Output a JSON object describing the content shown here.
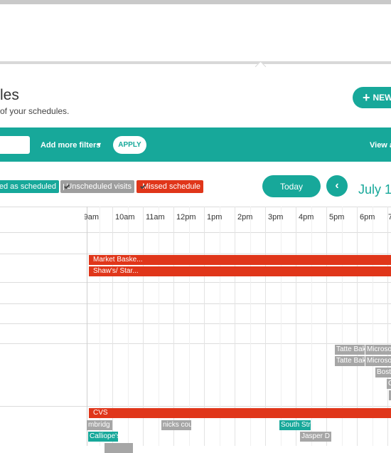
{
  "page": {
    "title": "les",
    "subtitle": "of your schedules.",
    "new_button": "NEW"
  },
  "filters": {
    "add_more_filters": "Add more filters",
    "apply": "APPLY",
    "view_all": "View a"
  },
  "legend": {
    "scheduled": "sited as scheduled",
    "unscheduled": "Unscheduled visits",
    "missed": "Missed schedule"
  },
  "nav": {
    "today": "Today",
    "prev_icon": "chevron-left-icon",
    "month": "July 1"
  },
  "timeline": {
    "hours": [
      "9am",
      "10am",
      "11am",
      "12pm",
      "1pm",
      "2pm",
      "3pm",
      "4pm",
      "5pm",
      "6pm",
      "7"
    ],
    "missed_events": [
      "Market Baske...",
      "Shaw's/ Star...",
      "CVS"
    ],
    "chips": [
      "Tatte Bak",
      "Microso",
      "Tatte Bak",
      "Microso",
      "Bost",
      "C",
      "mbridg",
      "nicks cou",
      "South Str",
      "Calliope's",
      "Jasper D"
    ]
  },
  "colors": {
    "accent": "#17a89a",
    "missed": "#e0361a",
    "unscheduled": "#9e9e9e"
  }
}
